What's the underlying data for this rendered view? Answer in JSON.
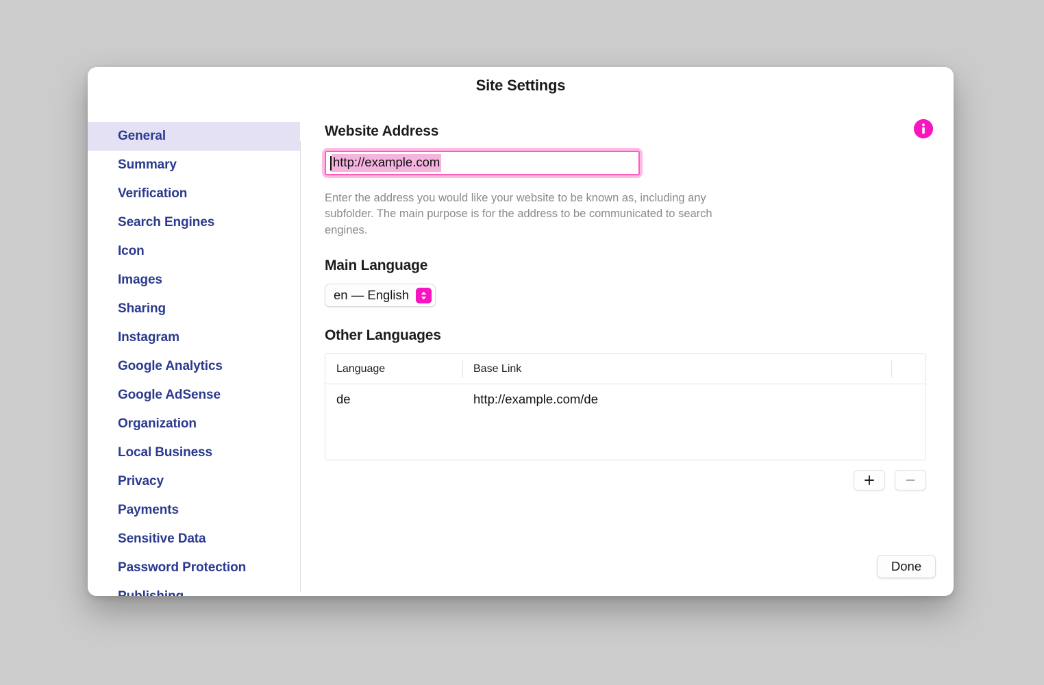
{
  "window": {
    "title": "Site Settings"
  },
  "sidebar": {
    "items": [
      {
        "label": "General",
        "selected": true
      },
      {
        "label": "Summary",
        "selected": false
      },
      {
        "label": "Verification",
        "selected": false
      },
      {
        "label": "Search Engines",
        "selected": false
      },
      {
        "label": "Icon",
        "selected": false
      },
      {
        "label": "Images",
        "selected": false
      },
      {
        "label": "Sharing",
        "selected": false
      },
      {
        "label": "Instagram",
        "selected": false
      },
      {
        "label": "Google Analytics",
        "selected": false
      },
      {
        "label": "Google AdSense",
        "selected": false
      },
      {
        "label": "Organization",
        "selected": false
      },
      {
        "label": "Local Business",
        "selected": false
      },
      {
        "label": "Privacy",
        "selected": false
      },
      {
        "label": "Payments",
        "selected": false
      },
      {
        "label": "Sensitive Data",
        "selected": false
      },
      {
        "label": "Password Protection",
        "selected": false
      },
      {
        "label": "Publishing",
        "selected": false
      }
    ]
  },
  "main": {
    "info_icon": "info-icon",
    "website_address": {
      "label": "Website Address",
      "value": "http://example.com",
      "placeholder": "http://example.com",
      "help": "Enter the address you would like your website to be known as, including any subfolder. The main purpose is for the address to be communicated to search engines."
    },
    "main_language": {
      "label": "Main Language",
      "selected": "en — English"
    },
    "other_languages": {
      "label": "Other Languages",
      "columns": [
        "Language",
        "Base Link"
      ],
      "rows": [
        {
          "language": "de",
          "base_link": "http://example.com/de"
        }
      ],
      "add_label": "+",
      "remove_label": "—"
    }
  },
  "footer": {
    "done_label": "Done"
  },
  "colors": {
    "accent_magenta": "#f715bf",
    "focus_pink": "#ff5cc0",
    "selection_pink": "#f5b4e0",
    "sidebar_selected_bg": "#e4e1f4",
    "sidebar_text": "#2b3a8f",
    "desktop_bg": "#cccccc"
  }
}
